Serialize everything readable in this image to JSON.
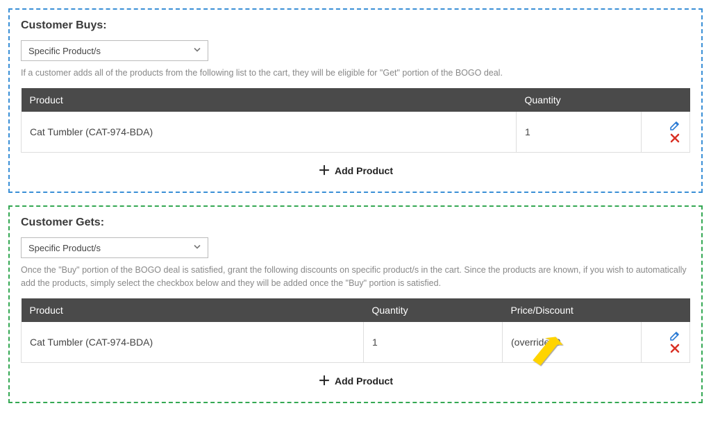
{
  "buys": {
    "title": "Customer Buys:",
    "selectValue": "Specific Product/s",
    "helpText": "If a customer adds all of the products from the following list to the cart, they will be eligible for \"Get\" portion of the BOGO deal.",
    "columns": {
      "product": "Product",
      "quantity": "Quantity"
    },
    "row": {
      "product": "Cat Tumbler (CAT-974-BDA)",
      "quantity": "1"
    },
    "addLabel": "Add Product"
  },
  "gets": {
    "title": "Customer Gets:",
    "selectValue": "Specific Product/s",
    "helpText": "Once the \"Buy\" portion of the BOGO deal is satisfied, grant the following discounts on specific product/s in the cart. Since the products are known, if you wish to automatically add the products, simply select the checkbox below and they will be added once the \"Buy\" portion is satisfied.",
    "columns": {
      "product": "Product",
      "quantity": "Quantity",
      "price": "Price/Discount"
    },
    "row": {
      "product": "Cat Tumbler (CAT-974-BDA)",
      "quantity": "1",
      "price": "(override) 0"
    },
    "addLabel": "Add Product"
  }
}
